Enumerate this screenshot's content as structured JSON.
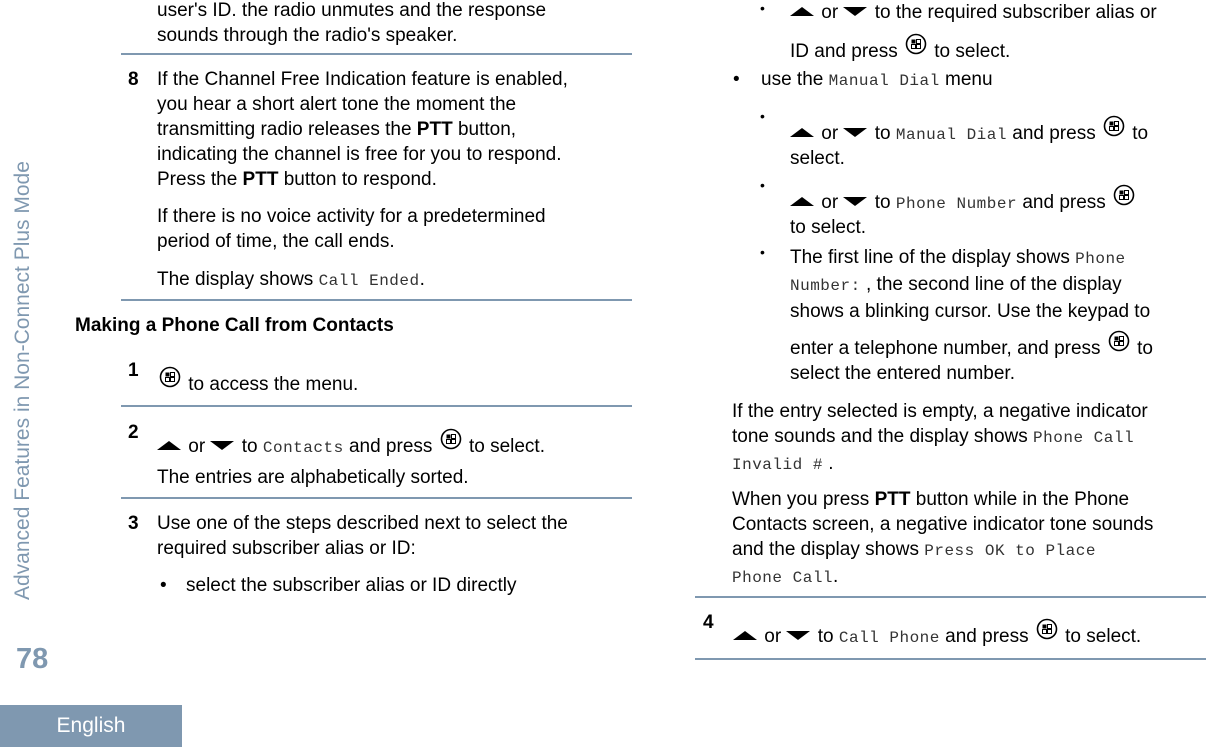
{
  "sidebar": {
    "chapter_title": "Advanced Features in Non-Connect Plus Mode",
    "page_number": "78",
    "language_tab": "English"
  },
  "left": {
    "intro": {
      "line1": "user's ID. the radio unmutes and the response",
      "line2": "sounds through the radio's speaker."
    },
    "step8": {
      "number": "8",
      "lines": [
        "If the Channel Free Indication feature is enabled,",
        "you hear a short alert tone the moment the"
      ],
      "line3_pre": "transmitting radio releases the ",
      "line3_bold": "PTT",
      "line3_post": " button,",
      "line4": "indicating the channel is free for you to respond.",
      "line5_pre": "Press the ",
      "line5_bold": "PTT",
      "line5_post": " button to respond.",
      "para2_line1": "If there is no voice activity for a predetermined",
      "para2_line2": "period of time, the call ends.",
      "para3_pre": "The display shows ",
      "para3_mono": "Call Ended",
      "para3_post": "."
    },
    "section_heading": "Making a Phone Call from Contacts",
    "step1": {
      "number": "1",
      "text": " to access the menu."
    },
    "step2": {
      "number": "2",
      "or": " or ",
      "to": " to ",
      "mono": "Contacts",
      "press": " and press ",
      "select": " to select.",
      "note": "The entries are alphabetically sorted."
    },
    "step3": {
      "number": "3",
      "line1": "Use one of the steps described next to select the",
      "line2": "required subscriber alias or ID:",
      "bullet1": "select the subscriber alias or ID directly"
    }
  },
  "right": {
    "sub1": {
      "or": " or ",
      "text": " to the required subscriber alias or",
      "line2_pre": "ID and press ",
      "line2_post": " to select."
    },
    "bullet2": {
      "pre": "use the ",
      "mono": "Manual Dial",
      "post": " menu"
    },
    "sub2": {
      "or": " or ",
      "to": " to ",
      "mono": "Manual Dial",
      "press": " and press ",
      "post": " to",
      "line2": "select."
    },
    "sub3": {
      "or": " or ",
      "to": " to ",
      "mono": "Phone Number",
      "press": " and press ",
      "line2": "to select."
    },
    "sub4": {
      "line1_pre": "The first line of the display shows ",
      "line1_mono": "Phone",
      "line2_mono": "Number:",
      "line2_post": " , the second line of the display",
      "line3": "shows a blinking cursor. Use the keypad to",
      "line4_pre": "enter a telephone number, and press ",
      "line4_post": " to",
      "line5": "select the entered number."
    },
    "para_empty": {
      "line1": "If the entry selected is empty, a negative indicator",
      "line2_pre": "tone sounds and the display shows ",
      "line2_mono": "Phone Call",
      "line3_mono": "Invalid #",
      "line3_post": " ."
    },
    "para_ptt": {
      "line1_pre": "When you press ",
      "line1_bold": "PTT",
      "line1_post": " button while in the Phone",
      "line2": "Contacts screen, a negative indicator tone sounds",
      "line3_pre": "and the display shows ",
      "line3_mono": "Press OK to Place",
      "line4_mono": "Phone Call",
      "line4_post": "."
    },
    "step4": {
      "number": "4",
      "or": " or ",
      "to": " to ",
      "mono": "Call Phone",
      "press": " and press ",
      "select": " to select."
    }
  },
  "bullet_glyph": "•"
}
